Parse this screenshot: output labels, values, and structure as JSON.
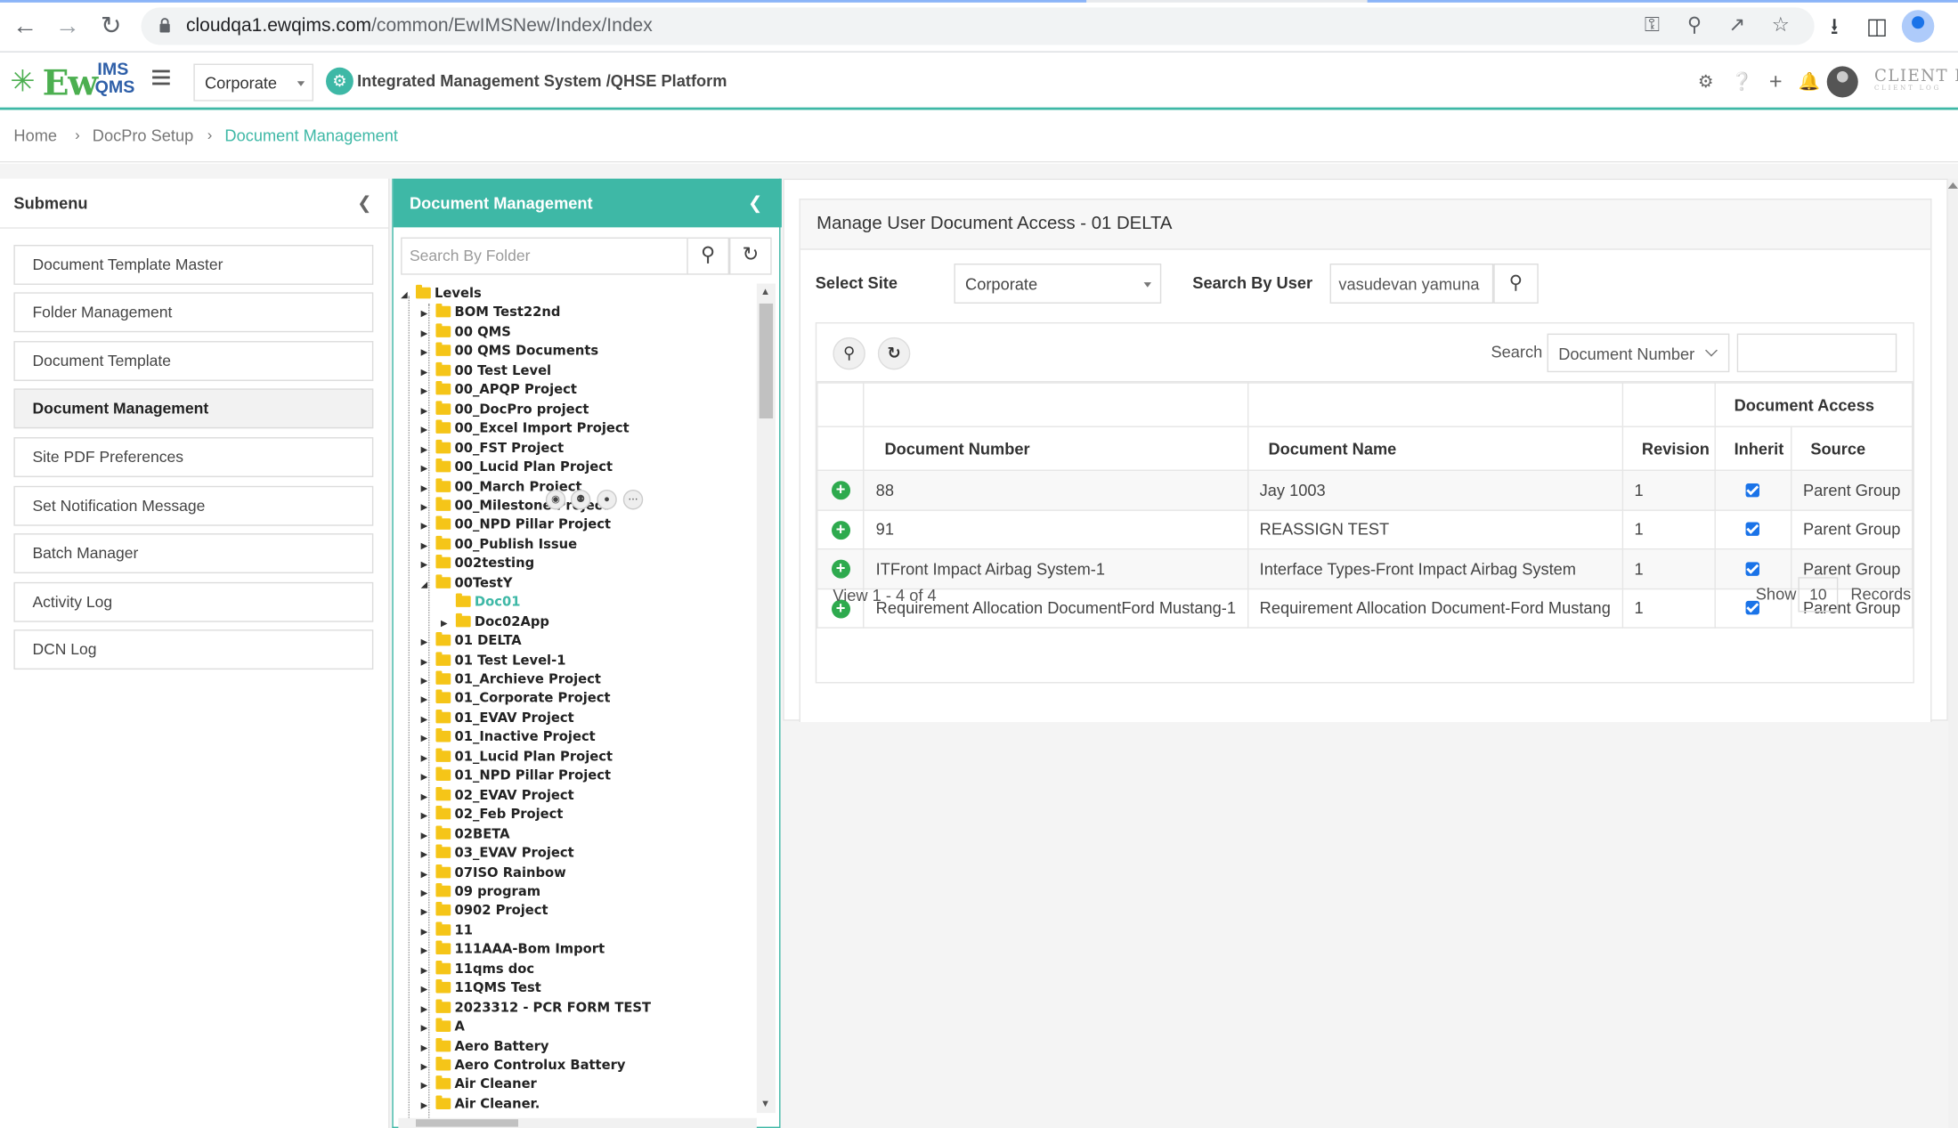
{
  "browser": {
    "url_host": "cloudqa1.ewqims.com",
    "url_path": "/common/EwIMSNew/Index/Index"
  },
  "header": {
    "logo_main": "Ew",
    "logo_top": "IMS",
    "logo_bottom": "QMS",
    "site_selected": "Corporate",
    "platform_title": "Integrated Management System /QHSE Platform",
    "client_logo": "CLIENT LOG",
    "client_logo_sub": "CLIENT LOG"
  },
  "breadcrumb": {
    "home": "Home",
    "setup": "DocPro Setup",
    "current": "Document Management"
  },
  "submenu": {
    "title": "Submenu",
    "items": [
      "Document Template Master",
      "Folder Management",
      "Document Template",
      "Document Management",
      "Site PDF Preferences",
      "Set Notification Message",
      "Batch Manager",
      "Activity Log",
      "DCN Log"
    ],
    "active_index": 3
  },
  "docpanel": {
    "title": "Document Management",
    "search_placeholder": "Search By Folder",
    "root": "Levels",
    "nodes_before": [
      "BOM Test22nd",
      "00 QMS",
      "00 QMS Documents",
      "00 Test Level",
      "00_APQP Project",
      "00_DocPro project",
      "00_Excel Import Project",
      "00_FST Project",
      "00_Lucid Plan Project",
      "00_March Project",
      "00_Milestone Project",
      "00_NPD Pillar Project",
      "00_Publish Issue",
      "002testing",
      "00TestY"
    ],
    "children": [
      "Doc01",
      "Doc02App"
    ],
    "nodes_after": [
      "01 DELTA",
      "01 Test Level-1",
      "01_Archieve Project",
      "01_Corporate Project",
      "01_EVAV Project",
      "01_Inactive Project",
      "01_Lucid Plan Project",
      "01_NPD Pillar Project",
      "02_EVAV Project",
      "02_Feb Project",
      "02BETA",
      "03_EVAV Project",
      "07ISO Rainbow",
      "09 program",
      "0902 Project",
      "11",
      "111AAA-Bom Import",
      "11qms doc",
      "11QMS Test",
      "2023312 - PCR FORM TEST",
      "A",
      "Aero Battery",
      "Aero Controlux Battery",
      "Air Cleaner",
      "Air Cleaner."
    ]
  },
  "main": {
    "title": "Manage User Document Access - 01 DELTA",
    "select_site_label": "Select Site",
    "site_value": "Corporate",
    "search_user_label": "Search By User",
    "user_value": "vasudevan yamuna",
    "search_label": "Search",
    "search_field": "Document Number",
    "columns": {
      "group": "Document Access",
      "doc_number": "Document Number",
      "doc_name": "Document Name",
      "revision": "Revision",
      "inherit": "Inherit",
      "source": "Source"
    },
    "rows": [
      {
        "number": "88",
        "name": "Jay 1003",
        "revision": "1",
        "inherit": true,
        "source": "Parent Group"
      },
      {
        "number": "91",
        "name": "REASSIGN TEST",
        "revision": "1",
        "inherit": true,
        "source": "Parent Group"
      },
      {
        "number": "ITFront Impact Airbag System-1",
        "name": "Interface Types-Front Impact Airbag System",
        "revision": "1",
        "inherit": true,
        "source": "Parent Group"
      },
      {
        "number": "Requirement Allocation DocumentFord Mustang-1",
        "name": "Requirement Allocation Document-Ford Mustang",
        "revision": "1",
        "inherit": true,
        "source": "Parent Group"
      }
    ],
    "pager_text": "View 1 - 4 of 4",
    "show_label": "Show",
    "page_size": "10",
    "records_label": "Records"
  }
}
